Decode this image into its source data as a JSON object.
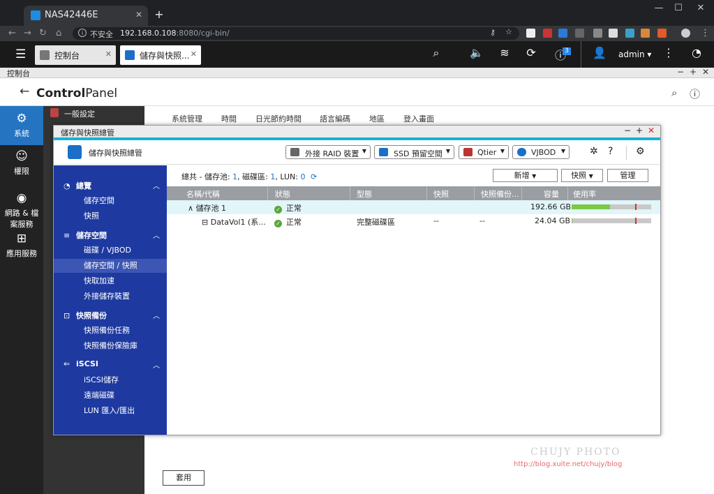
{
  "browser": {
    "tab_title": "NAS42446E",
    "address_security": "不安全",
    "address_host": "192.168.0.108",
    "address_path": ":8080/cgi-bin/"
  },
  "qnap": {
    "tabs": [
      {
        "label": "控制台"
      },
      {
        "label": "儲存與快照..."
      }
    ],
    "user": "admin",
    "notification_count": "3"
  },
  "control_panel": {
    "window_title": "控制台",
    "header_title_bold": "Control",
    "header_title_rest": "Panel",
    "left_nav": [
      {
        "label": "系統",
        "icon": "gear-icon"
      },
      {
        "label": "權限",
        "icon": "user-icon"
      },
      {
        "label_line1": "網路 & 檔",
        "label_line2": "案服務",
        "icon": "globe-icon"
      },
      {
        "label": "應用服務",
        "icon": "grid-icon"
      }
    ],
    "sub_item": "一般設定",
    "tabs": [
      "系統管理",
      "時間",
      "日光節約時間",
      "語言編碼",
      "地區",
      "登入畫面"
    ],
    "apply_label": "套用"
  },
  "storage": {
    "window_title": "儲存與快照總管",
    "header_title": "儲存與快照總管",
    "toolbar": {
      "external_raid": "外接 RAID 裝置",
      "ssd": "SSD 預留空間",
      "qtier": "Qtier",
      "vjbod": "VJBOD"
    },
    "sidebar": {
      "overview": {
        "label": "總覽",
        "items": [
          "儲存空間",
          "快照"
        ]
      },
      "storage": {
        "label": "儲存空間",
        "items": [
          "磁碟 / VJBOD",
          "儲存空間 / 快照",
          "快取加速",
          "外接儲存裝置"
        ]
      },
      "backup": {
        "label": "快照備份",
        "items": [
          "快照備份任務",
          "快照備份保險庫"
        ]
      },
      "iscsi": {
        "label": "iSCSI",
        "items": [
          "iSCSI儲存",
          "遠端磁碟",
          "LUN 匯入/匯出"
        ]
      }
    },
    "summary": {
      "prefix": "總共 - 儲存池:",
      "pools": "1",
      "disk_label": ", 磁碟區:",
      "volumes": "1",
      "lun_label": ", LUN:",
      "luns": "0"
    },
    "buttons": {
      "new": "新增",
      "snapshot": "快照",
      "manage": "管理"
    },
    "columns": [
      "名稱/代稱",
      "狀態",
      "型態",
      "快照",
      "快照備份...",
      "容量",
      "使用率"
    ],
    "rows": [
      {
        "name": "儲存池 1",
        "status": "正常",
        "type": "",
        "snapshot": "",
        "backup": "",
        "capacity": "192.66 GB",
        "usage": 0.48,
        "threshold": 0.8
      },
      {
        "name": "DataVol1 (系...",
        "status": "正常",
        "type": "完整磁碟區",
        "snapshot": "--",
        "backup": "--",
        "capacity": "24.04 GB",
        "usage": 0.01,
        "threshold": 0.8
      }
    ]
  },
  "watermark": {
    "line1": "CHUJY PHOTO",
    "line2": "http://blog.xuite.net/chujy/blog"
  }
}
